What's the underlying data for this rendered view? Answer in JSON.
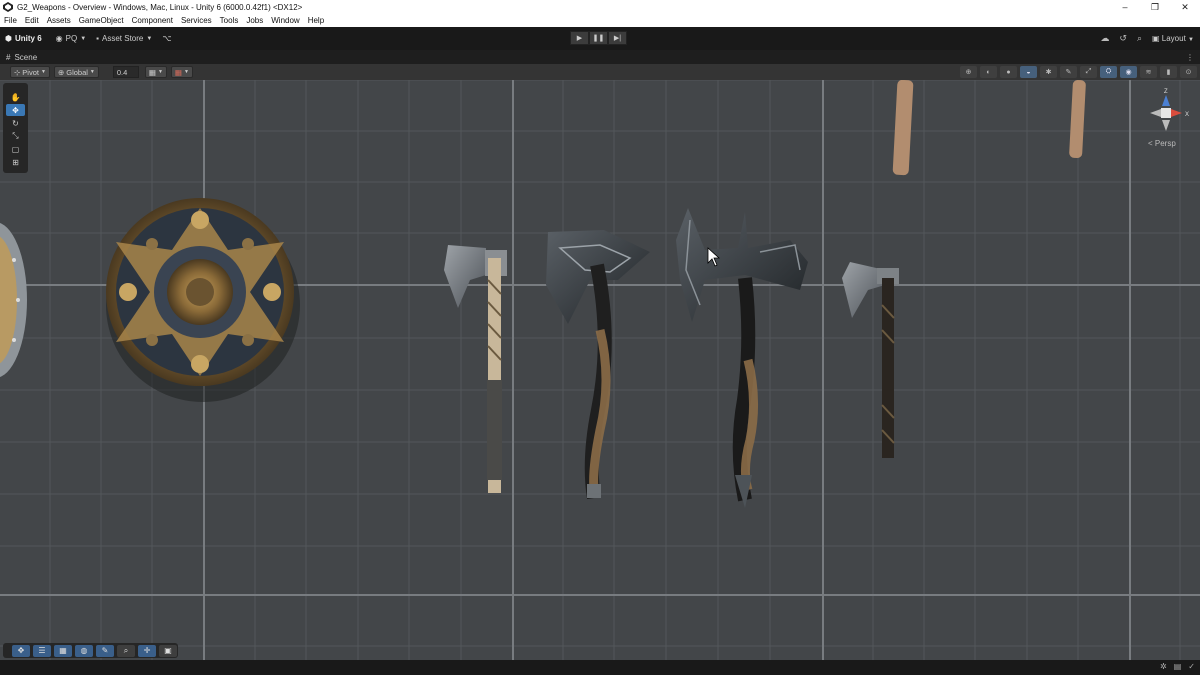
{
  "window": {
    "title": "G2_Weapons - Overview - Windows, Mac, Linux - Unity 6 (6000.0.42f1) <DX12>",
    "controls": {
      "minimize": "–",
      "restore": "❐",
      "close": "✕"
    }
  },
  "menu": [
    "File",
    "Edit",
    "Assets",
    "GameObject",
    "Component",
    "Services",
    "Tools",
    "Jobs",
    "Window",
    "Help"
  ],
  "toolbar": {
    "unity_label": "Unity 6",
    "account_label": "PQ",
    "asset_store_label": "Asset Store",
    "play_icons": {
      "play": "▶",
      "pause": "❚❚",
      "step": "▶|"
    },
    "layout_label": "Layout"
  },
  "scene_tab": {
    "label": "Scene"
  },
  "scene_toolbar": {
    "pivot_label": "Pivot",
    "global_label": "Global",
    "grid_size_value": "0.4"
  },
  "scene_view": {
    "projection_label": "< Persp",
    "gizmo_axes": {
      "y": "Z",
      "x": "X"
    }
  },
  "colors": {
    "accent": "#3a78b5",
    "viewport_bg": "#434649",
    "toolbar_bg": "#191919",
    "axis_z": "#4a7fd3",
    "axis_x": "#d94c3d"
  }
}
